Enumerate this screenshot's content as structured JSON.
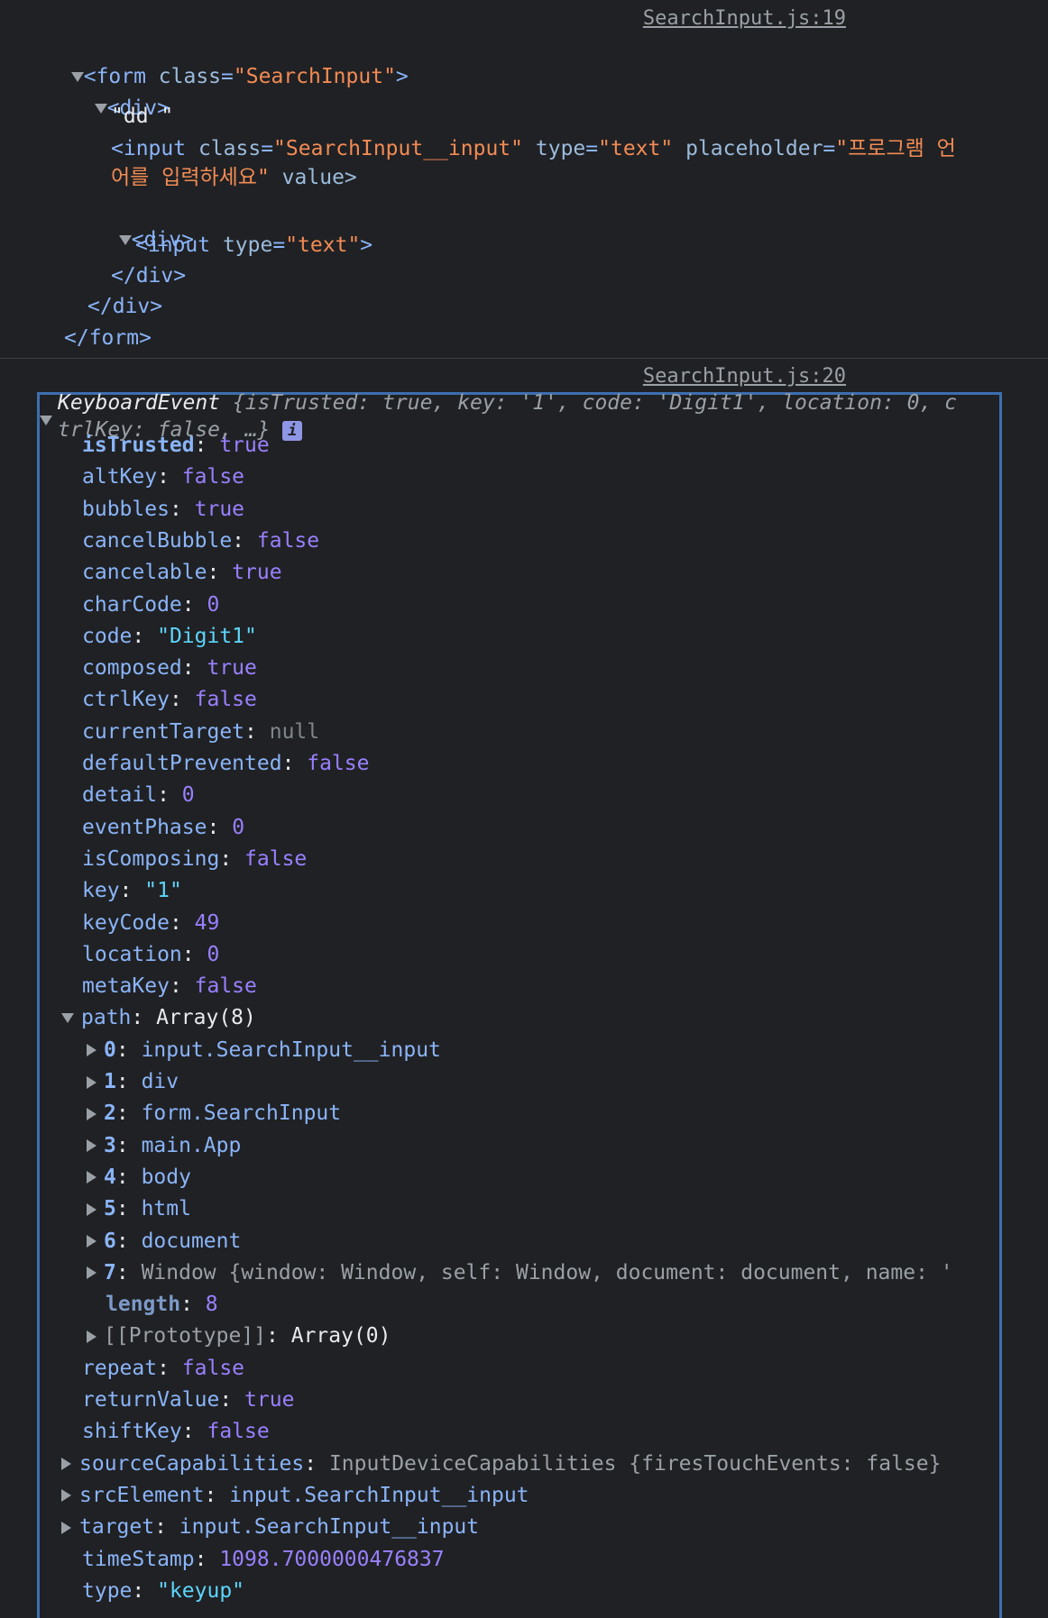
{
  "elements_log": {
    "source_link": "SearchInput.js:19",
    "form_open": {
      "tag": "form",
      "attr": "class",
      "val": "SearchInput"
    },
    "div_open": "<div>",
    "text_node": "\"dd \"",
    "input1": {
      "class_val": "SearchInput__input",
      "type_val": "text",
      "placeholder_part1": "프로그램 언",
      "placeholder_part2": "어를 입력하세요",
      "tail": " value>"
    },
    "inner_div": "<div>",
    "input2": {
      "type_val": "text"
    },
    "inner_div_close": "</div>",
    "div_close": "</div>",
    "form_close": "</form>"
  },
  "event_log": {
    "source_link": "SearchInput.js:20",
    "summary": {
      "name": "KeyboardEvent",
      "line1_rest": "{isTrusted: true, key: '1', code: 'Digit1', location: 0, c",
      "line2": "trlKey: false, …}",
      "info_badge": "i"
    },
    "props": [
      {
        "k": "isTrusted",
        "v": "true",
        "t": "bool",
        "own": true
      },
      {
        "k": "altKey",
        "v": "false",
        "t": "bool"
      },
      {
        "k": "bubbles",
        "v": "true",
        "t": "bool"
      },
      {
        "k": "cancelBubble",
        "v": "false",
        "t": "bool"
      },
      {
        "k": "cancelable",
        "v": "true",
        "t": "bool"
      },
      {
        "k": "charCode",
        "v": "0",
        "t": "num"
      },
      {
        "k": "code",
        "v": "\"Digit1\"",
        "t": "sstr"
      },
      {
        "k": "composed",
        "v": "true",
        "t": "bool"
      },
      {
        "k": "ctrlKey",
        "v": "false",
        "t": "bool"
      },
      {
        "k": "currentTarget",
        "v": "null",
        "t": "nul"
      },
      {
        "k": "defaultPrevented",
        "v": "false",
        "t": "bool"
      },
      {
        "k": "detail",
        "v": "0",
        "t": "num"
      },
      {
        "k": "eventPhase",
        "v": "0",
        "t": "num"
      },
      {
        "k": "isComposing",
        "v": "false",
        "t": "bool"
      },
      {
        "k": "key",
        "v": "\"1\"",
        "t": "sstr"
      },
      {
        "k": "keyCode",
        "v": "49",
        "t": "num"
      },
      {
        "k": "location",
        "v": "0",
        "t": "num"
      },
      {
        "k": "metaKey",
        "v": "false",
        "t": "bool"
      }
    ],
    "path": {
      "k": "path",
      "v": "Array(8)",
      "items": [
        {
          "i": "0",
          "v": "input.SearchInput__input"
        },
        {
          "i": "1",
          "v": "div"
        },
        {
          "i": "2",
          "v": "form.SearchInput"
        },
        {
          "i": "3",
          "v": "main.App"
        },
        {
          "i": "4",
          "v": "body"
        },
        {
          "i": "5",
          "v": "html"
        },
        {
          "i": "6",
          "v": "document"
        }
      ],
      "item7": {
        "i": "7",
        "v": "Window {window: Window, self: Window, document: document, name: '"
      },
      "length": {
        "k": "length",
        "v": "8"
      },
      "proto": {
        "k": "[[Prototype]]",
        "v": "Array(0)"
      }
    },
    "props2": [
      {
        "k": "repeat",
        "v": "false",
        "t": "bool"
      },
      {
        "k": "returnValue",
        "v": "true",
        "t": "bool"
      },
      {
        "k": "shiftKey",
        "v": "false",
        "t": "bool"
      }
    ],
    "expandables": [
      {
        "k": "sourceCapabilities",
        "v": "InputDeviceCapabilities {firesTouchEvents: false}"
      },
      {
        "k": "srcElement",
        "v": "input.SearchInput__input"
      },
      {
        "k": "target",
        "v": "input.SearchInput__input"
      }
    ],
    "props3": [
      {
        "k": "timeStamp",
        "v": "1098.7000000476837",
        "t": "num"
      },
      {
        "k": "type",
        "v": "\"keyup\"",
        "t": "sstr"
      }
    ]
  }
}
